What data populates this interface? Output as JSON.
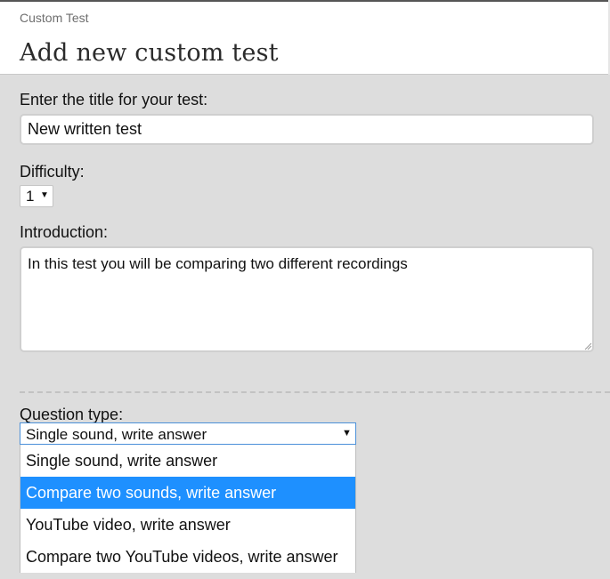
{
  "header": {
    "breadcrumb": "Custom Test",
    "title": "Add new custom test"
  },
  "form": {
    "title_label": "Enter the title for your test:",
    "title_value": "New written test",
    "difficulty_label": "Difficulty:",
    "difficulty_value": "1",
    "introduction_label": "Introduction:",
    "introduction_value": "In this test you will be comparing two different recordings",
    "question_type_label": "Question type:",
    "question_type_value": "Single sound, write answer",
    "question_type_options": [
      "Single sound, write answer",
      "Compare two sounds, write answer",
      "YouTube video, write answer",
      "Compare two YouTube videos, write answer"
    ],
    "highlighted_option": "Compare two sounds, write answer"
  },
  "icons": {
    "dropdown_arrow": "chevron-down-icon",
    "resize_grip": "resize-grip-icon"
  },
  "colors": {
    "highlight": "#1e90ff",
    "background": "#dddddd",
    "focus_border": "#4a90d9"
  }
}
